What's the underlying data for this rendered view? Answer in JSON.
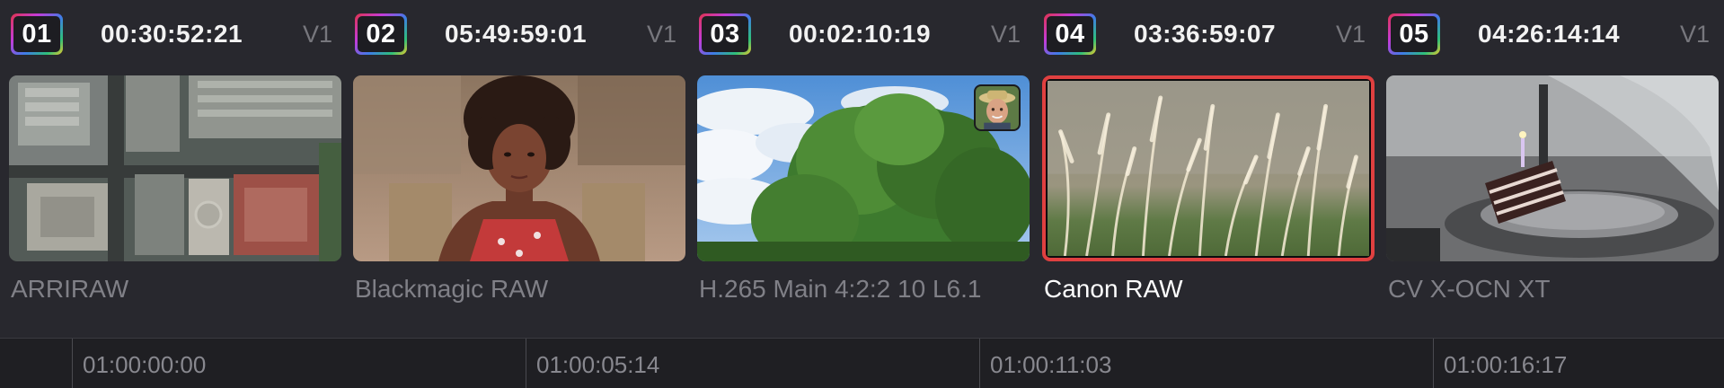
{
  "clips": [
    {
      "number": "01",
      "timecode": "00:30:52:21",
      "track": "V1",
      "name": "ARRIRAW",
      "thumbnail": "aerial-city-rooftops",
      "selected": false
    },
    {
      "number": "02",
      "timecode": "05:49:59:01",
      "track": "V1",
      "name": "Blackmagic RAW",
      "thumbnail": "woman-portrait",
      "selected": false
    },
    {
      "number": "03",
      "timecode": "00:02:10:19",
      "track": "V1",
      "name": "H.265 Main 4:2:2 10 L6.1",
      "thumbnail": "tree-blue-sky",
      "badge": "person-face-icon",
      "selected": false
    },
    {
      "number": "04",
      "timecode": "03:36:59:07",
      "track": "V1",
      "name": "Canon RAW",
      "thumbnail": "grass-seed-heads",
      "selected": true
    },
    {
      "number": "05",
      "timecode": "04:26:14:14",
      "track": "V1",
      "name": "CV X-OCN XT",
      "thumbnail": "birthday-cake-candle",
      "selected": false
    }
  ],
  "ruler": {
    "labels": [
      "01:00:00:00",
      "01:00:05:14",
      "01:00:11:03",
      "01:00:16:17"
    ]
  },
  "colors": {
    "background": "#28282e",
    "selected_border": "#e04040",
    "ruler_background": "#1f1f23"
  }
}
